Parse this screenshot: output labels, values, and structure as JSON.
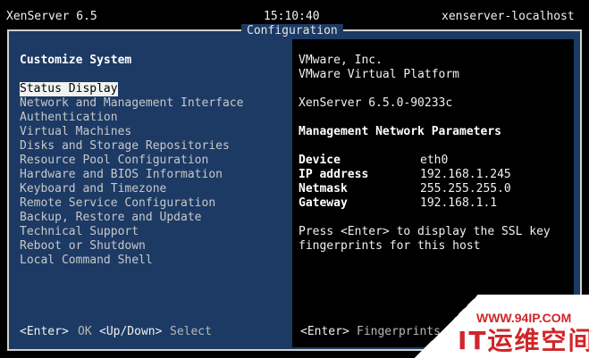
{
  "topbar": {
    "product": "XenServer 6.5",
    "clock": "15:10:40",
    "hostname": "xenserver-localhost"
  },
  "frame": {
    "title": "Configuration"
  },
  "left": {
    "heading": "Customize System",
    "menu": [
      "Status Display",
      "Network and Management Interface",
      "Authentication",
      "Virtual Machines",
      "Disks and Storage Repositories",
      "Resource Pool Configuration",
      "Hardware and BIOS Information",
      "Keyboard and Timezone",
      "Remote Service Configuration",
      "Backup, Restore and Update",
      "Technical Support",
      "Reboot or Shutdown",
      "Local Command Shell"
    ],
    "selected_index": 0,
    "hint_key1": "<Enter>",
    "hint_text1": "OK",
    "hint_key2": "<Up/Down>",
    "hint_text2": "Select"
  },
  "right": {
    "vendor": "VMware, Inc.",
    "platform": "VMware Virtual Platform",
    "version": "XenServer 6.5.0-90233c",
    "section_title": "Management Network Parameters",
    "params": [
      {
        "label": "Device",
        "value": "eth0"
      },
      {
        "label": "IP address",
        "value": "192.168.1.245"
      },
      {
        "label": "Netmask",
        "value": "255.255.255.0"
      },
      {
        "label": "Gateway",
        "value": "192.168.1.1"
      }
    ],
    "note_line1": "Press <Enter> to display the SSL key",
    "note_line2": "fingerprints for this host",
    "hint_key": "<Enter>",
    "hint_text": "Fingerprints"
  },
  "watermark": {
    "url": "WWW.94IP.COM",
    "brand": "IT运维空间"
  },
  "colors": {
    "panel_blue": "#1c3a64",
    "selection": "#f2f2f2",
    "watermark_red": "#d0262a"
  }
}
